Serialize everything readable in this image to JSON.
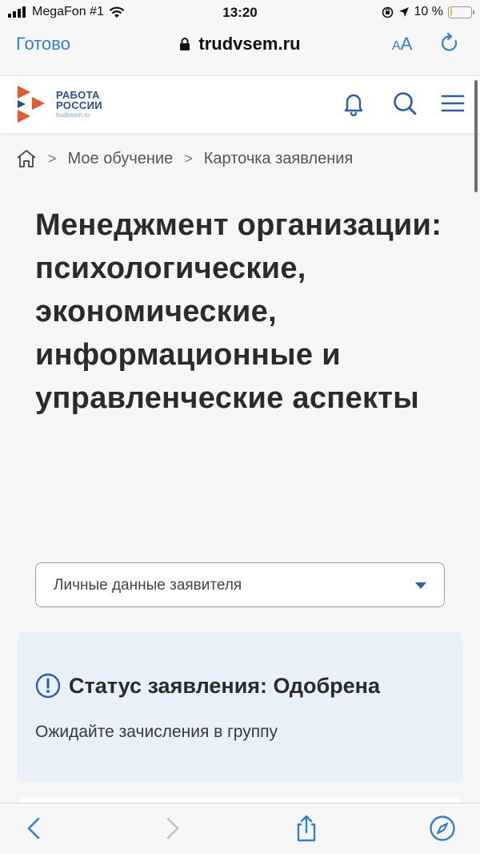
{
  "status_bar": {
    "carrier": "MegaFon #1",
    "time": "13:20",
    "battery_percent": "10 %",
    "battery_level": 0.1
  },
  "browser": {
    "done_label": "Готово",
    "url": "trudvsem.ru",
    "text_size_small": "A",
    "text_size_large": "A"
  },
  "site": {
    "logo_line1": "РАБОТА",
    "logo_line2": "РОССИИ",
    "logo_domain": "trudvsem.ru"
  },
  "breadcrumb": {
    "items": [
      "Мое обучение",
      "Карточка заявления"
    ],
    "separator": ">"
  },
  "course": {
    "title": "Менеджмент организации: психологические, экономические, информационные и управленческие аспекты"
  },
  "section_select": {
    "value": "Личные данные заявителя"
  },
  "status": {
    "title": "Статус заявления: Одобрена",
    "message": "Ожидайте зачисления в группу"
  },
  "icons": {
    "home": "home-icon",
    "bell": "bell-icon",
    "search": "search-icon",
    "menu": "hamburger-menu-icon",
    "info": "exclamation-circle-icon",
    "lock": "lock-icon",
    "reload": "reload-icon",
    "back": "back-arrow-icon",
    "forward": "forward-arrow-icon",
    "share": "share-icon",
    "compass": "compass-icon"
  },
  "colors": {
    "accent_blue": "#2f80d6",
    "brand_blue": "#2a4f8f",
    "brand_orange": "#e8562a",
    "status_card_bg": "#e8f0f9"
  }
}
